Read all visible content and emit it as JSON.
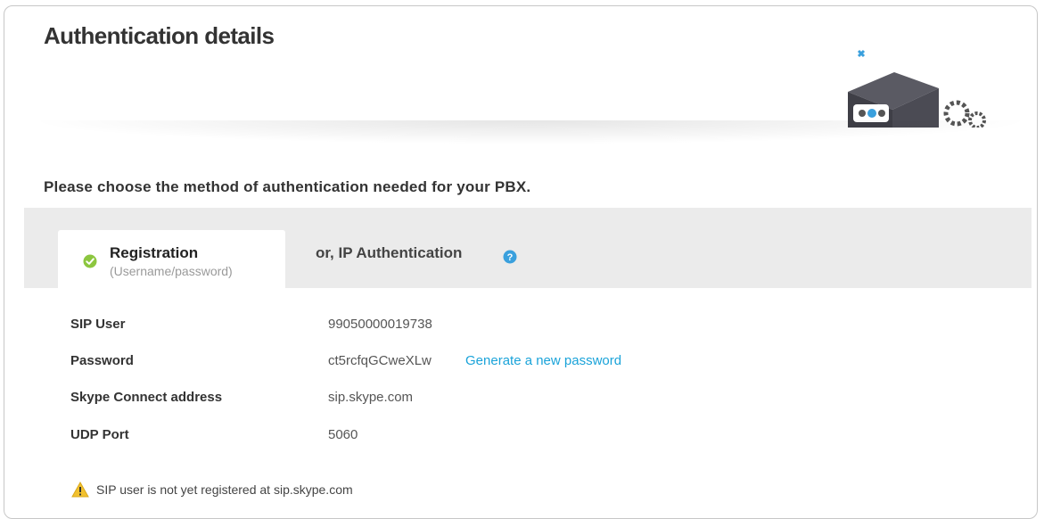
{
  "header": {
    "title": "Authentication details"
  },
  "instructions": "Please choose the method of authentication needed for your PBX.",
  "tabs": {
    "registration": {
      "title": "Registration",
      "subtitle": "(Username/password)"
    },
    "ip_auth": {
      "title": "or, IP Authentication"
    }
  },
  "details": {
    "sip_user": {
      "label": "SIP User",
      "value": "99050000019738"
    },
    "password": {
      "label": "Password",
      "value": "ct5rcfqGCweXLw",
      "link": "Generate a new password"
    },
    "address": {
      "label": "Skype Connect address",
      "value": "sip.skype.com"
    },
    "udp_port": {
      "label": "UDP Port",
      "value": "5060"
    }
  },
  "warning": {
    "text": "SIP user is not yet registered at sip.skype.com"
  },
  "icons": {
    "registration_status": "check-circle-icon",
    "help": "question-circle-icon",
    "warning": "warning-triangle-icon",
    "illustration": "pbx-device-icon"
  },
  "colors": {
    "accent_link": "#1aa3d9",
    "success": "#8cc63f",
    "warning": "#f2c12e",
    "tab_strip": "#ebebeb"
  }
}
